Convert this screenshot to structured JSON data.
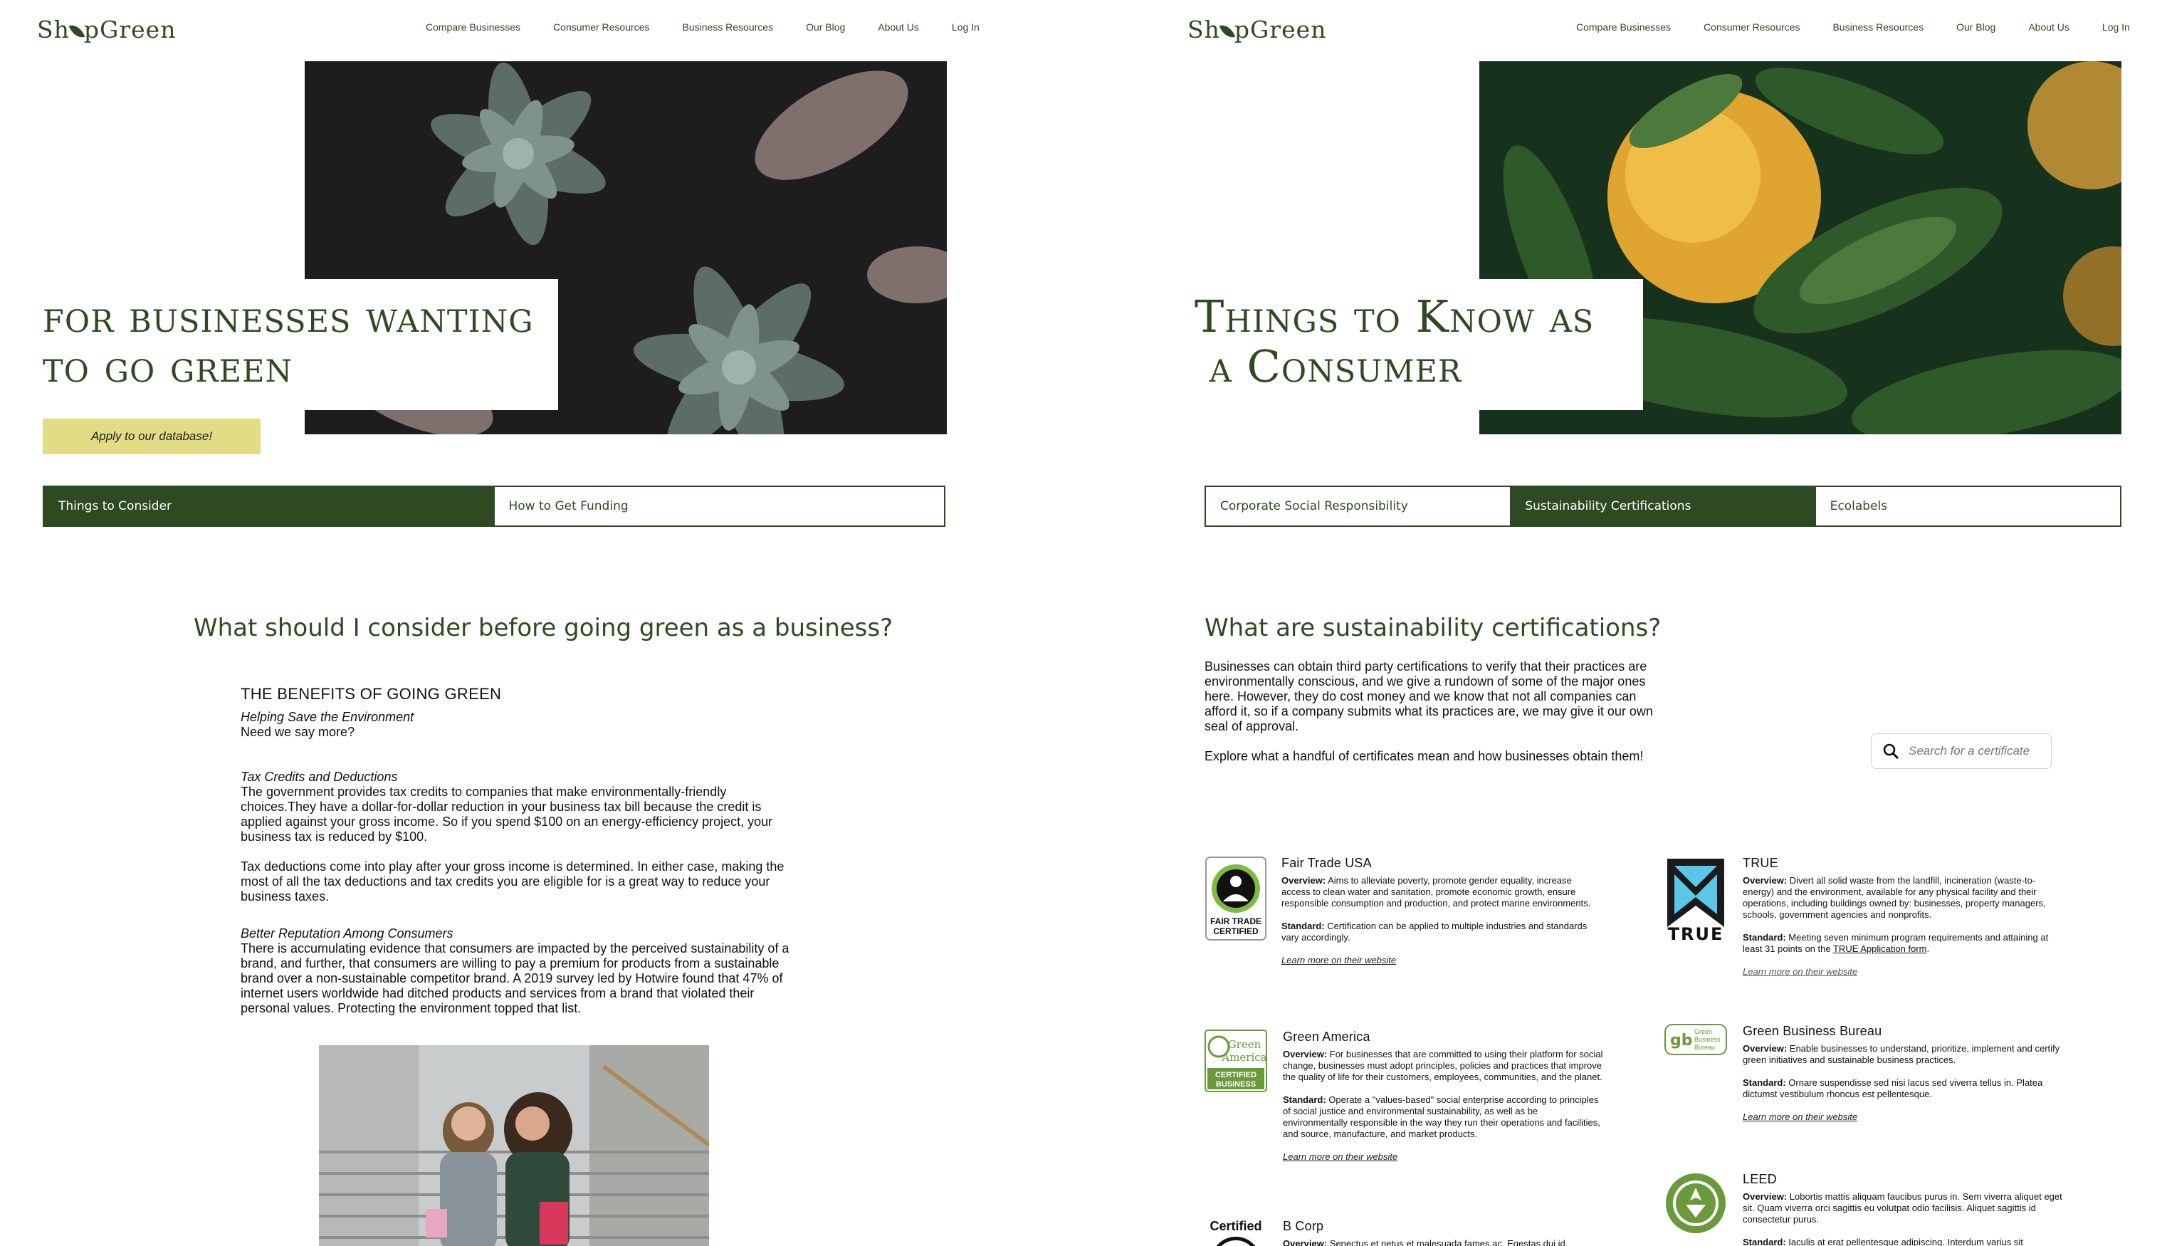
{
  "brand": {
    "logo_before": "Sh",
    "logo_after": "pGreen",
    "green": "#2f4a22",
    "yellow": "#e2dc85"
  },
  "nav": [
    "Compare Businesses",
    "Consumer Resources",
    "Business Resources",
    "Our Blog",
    "About Us",
    "Log In"
  ],
  "left": {
    "hero_title_line1": "for businesses wanting",
    "hero_title_line2": "to go green",
    "apply_button": "Apply to our database!",
    "tabs": [
      {
        "label": "Things to Consider",
        "active": true
      },
      {
        "label": "How to Get Funding",
        "active": false
      }
    ],
    "section_title": "What should I consider before going green as a business?",
    "article": {
      "heading": "THE BENEFITS OF GOING GREEN",
      "s1_title": "Helping Save the Environment",
      "s1_text": "Need we say more?",
      "s2_title": "Tax Credits and Deductions",
      "s2_text": "The government provides tax credits to companies that make environmentally-friendly choices.They have a dollar-for-dollar reduction in your business tax bill because the credit is applied against your gross income. So if you spend $100 on an energy-efficiency project, your business tax is reduced by $100.",
      "s2_text2": "Tax deductions come into play after your gross income is determined. In either case, making the most of all the tax deductions and tax credits you are eligible for is a great way to reduce your business taxes.",
      "s3_title": "Better Reputation Among Consumers",
      "s3_text": "There is accumulating evidence that consumers are impacted by the perceived sustainability of a brand, and further, that consumers are willing to pay a premium for products from a sustainable brand over a non-sustainable competitor brand. A 2019 survey led by Hotwire found that 47% of internet users worldwide had ditched products and services from a brand that violated their personal values. Protecting the environment topped that list."
    }
  },
  "right": {
    "hero_title_line1": "Things to Know as",
    "hero_title_line2": "a Consumer",
    "tabs": [
      {
        "label": "Corporate Social Responsibility",
        "active": false
      },
      {
        "label": "Sustainability Certifications",
        "active": true
      },
      {
        "label": "Ecolabels",
        "active": false
      }
    ],
    "section_title": "What are sustainability certifications?",
    "intro_p1": "Businesses can obtain third party certifications to verify that their practices are environmentally conscious, and we give a rundown of some of the major ones here. However, they do cost money and we know that not all companies can afford it, so if a company submits what its practices are, we may give it our own seal of approval.",
    "intro_p2": "Explore what a handful of certificates mean and how businesses obtain them!",
    "search_placeholder": "Search for a certificate",
    "overview_label": "Overview:",
    "standard_label": "Standard:",
    "learn_more": "Learn more on their website",
    "certs": {
      "fairtrade": {
        "name": "Fair Trade USA",
        "logo_text1": "FAIR TRADE",
        "logo_text2": "CERTIFIED",
        "overview": "Aims to alleviate poverty, promote gender equality, increase access to clean water and sanitation, promote economic growth, ensure responsible consumption and production, and protect marine environments.",
        "standard": "Certification can be applied to multiple industries and standards vary accordingly."
      },
      "greenamerica": {
        "name": "Green America",
        "logo_text1": "Green",
        "logo_text2": "America",
        "logo_text3": "CERTIFIED",
        "logo_text4": "BUSINESS",
        "overview": "For businesses that are committed to using their platform for social change, businesses must adopt principles, policies and practices that improve the quality of life for their customers, employees, communities, and the planet.",
        "standard": "Operate a \"values-based\" social enterprise according to principles of social justice and environmental sustainability, as well as be environmentally responsible in the way they run their operations and facilities, and source, manufacture, and market products."
      },
      "bcorp": {
        "name": "B Corp",
        "logo_text": "Certified",
        "overview": "Senectus et netus et malesuada fames ac. Egestas dui id"
      },
      "true": {
        "name": "TRUE",
        "logo_text": "TRUE",
        "overview": "Divert all solid waste from the landfill, incineration (waste-to-energy) and the environment, available for any physical facility and their operations, including buildings owned by: businesses, property managers, schools, government agencies and nonprofits.",
        "standard_pre": "Meeting seven minimum program requirements and attaining at least 31 points on the",
        "standard_link": "TRUE Application form",
        "standard_post": "."
      },
      "gbb": {
        "name": "Green Business Bureau",
        "logo_text1": "Green",
        "logo_text2": "Business",
        "logo_text3": "Bureau",
        "overview": "Enable businesses to understand, prioritize, implement and certify green initiatives and sustainable business practices.",
        "standard": "Ornare suspendisse sed nisi lacus sed viverra tellus in. Platea dictumst vestibulum rhoncus est pellentesque."
      },
      "leed": {
        "name": "LEED",
        "overview": "Lobortis mattis aliquam faucibus purus in. Sem viverra aliquet eget sit. Quam viverra orci sagittis eu volutpat odio facilisis. Aliquet sagittis id consectetur purus.",
        "standard": "Iaculis at erat pellentesque adipiscing. Interdum varius sit"
      }
    }
  }
}
